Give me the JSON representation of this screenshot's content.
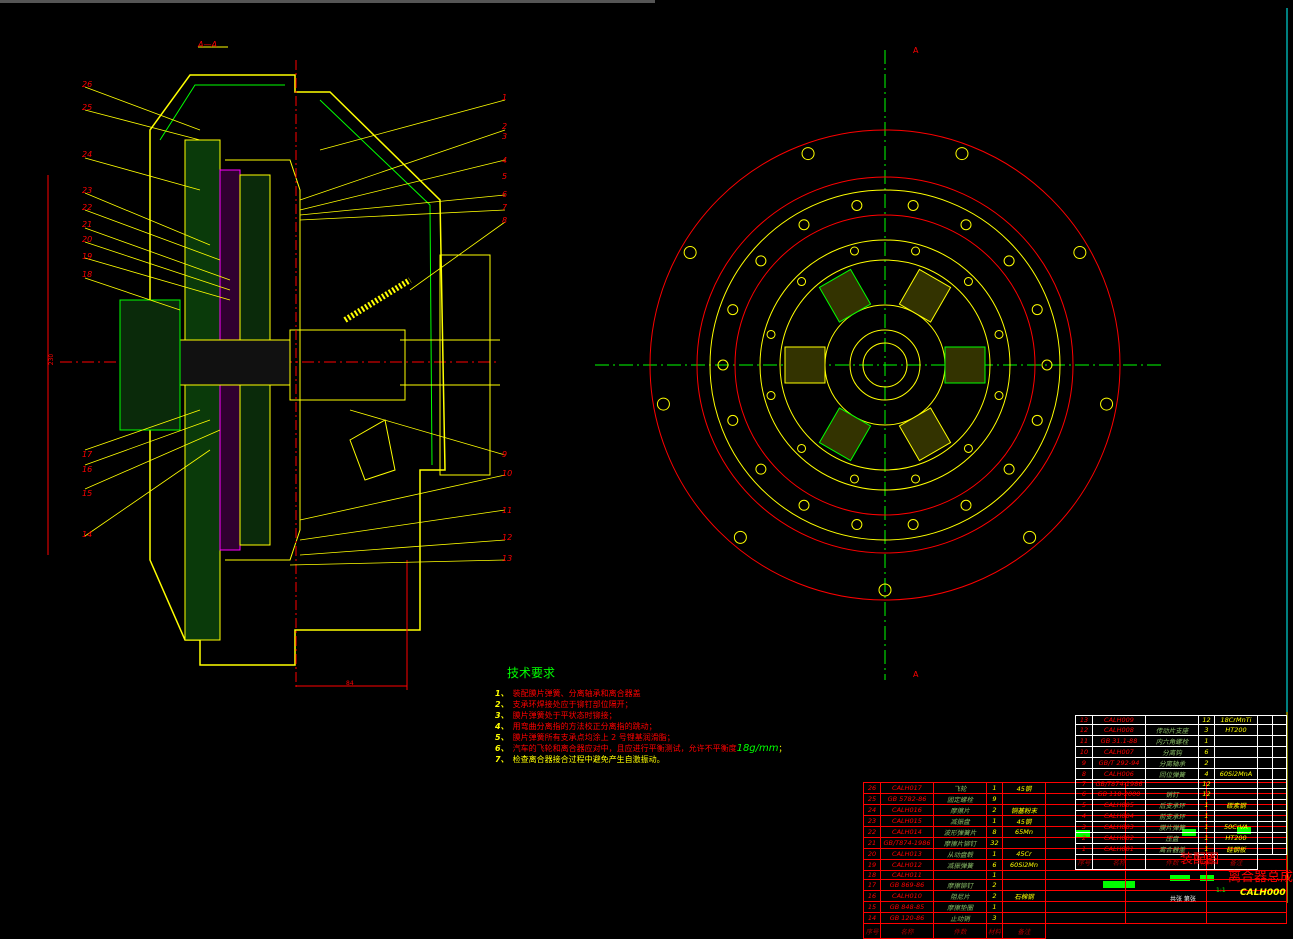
{
  "section_label": "A—A",
  "section_marks": [
    "A",
    "A"
  ],
  "dimensions": {
    "width": "84",
    "height": "230"
  },
  "leader_numbers_right": [
    "1",
    "2",
    "3",
    "4",
    "5",
    "6",
    "7",
    "8",
    "9",
    "10",
    "11",
    "12",
    "13"
  ],
  "leader_numbers_left": [
    "26",
    "25",
    "24",
    "23",
    "22",
    "21",
    "20",
    "19",
    "18",
    "17",
    "16",
    "15",
    "14"
  ],
  "tech": {
    "title": "技术要求",
    "items": [
      {
        "n": "1、",
        "text": "装配膜片弹簧、分离轴承和离合器盖"
      },
      {
        "n": "2、",
        "text": "支承环焊接处应于铆钉部位隔开；"
      },
      {
        "n": "3、",
        "text": "膜片弹簧处于平状态时铆接；"
      },
      {
        "n": "4、",
        "text": "用弯曲分离指的方法校正分离指的跳动；"
      },
      {
        "n": "5、",
        "text": "膜片弹簧所有支承点均涂上 2 号锂基润滑脂；"
      },
      {
        "n": "6、",
        "text": "汽车的飞轮和离合器应对中，且应进行平衡测试，允许不平衡度",
        "extra": "18g/mm",
        "end": "；"
      },
      {
        "n": "7、",
        "text": "检查离合器接合过程中避免产生自激振动。"
      }
    ]
  },
  "parts_lower": [
    [
      "26",
      "CALH017",
      "飞轮",
      "1",
      "45钢"
    ],
    [
      "25",
      "GB 5782-86",
      "固定螺栓",
      "9",
      ""
    ],
    [
      "24",
      "CALH016",
      "摩擦片",
      "2",
      "铜基粉末"
    ],
    [
      "23",
      "CALH015",
      "减振盘",
      "1",
      "45钢"
    ],
    [
      "22",
      "CALH014",
      "波形弹簧片",
      "8",
      "65Mn"
    ],
    [
      "21",
      "GB/T874-1986",
      "摩擦片铆钉",
      "32",
      ""
    ],
    [
      "20",
      "CALH013",
      "从动盘毂",
      "1",
      "45Cr"
    ],
    [
      "19",
      "CALH012",
      "减振弹簧",
      "6",
      "60Si2Mn"
    ],
    [
      "18",
      "CALH011",
      "",
      "1",
      ""
    ],
    [
      "17",
      "GB 869-86",
      "摩擦铆钉",
      "2",
      ""
    ],
    [
      "16",
      "CALH010",
      "阻尼片",
      "2",
      "石棉钢"
    ],
    [
      "15",
      "GB 848-85",
      "摩擦垫圈",
      "1",
      ""
    ],
    [
      "14",
      "GB 120-86",
      "止动销",
      "3",
      ""
    ]
  ],
  "parts_upper": [
    [
      "13",
      "CALH009",
      "",
      "12",
      "18CrMnTi"
    ],
    [
      "12",
      "CALH008",
      "传动片支座",
      "3",
      "HT200"
    ],
    [
      "11",
      "GB 31.1-88",
      "内六角螺栓",
      "1",
      ""
    ],
    [
      "10",
      "CALH007",
      "分离钩",
      "6",
      ""
    ],
    [
      "9",
      "GB/T 292-94",
      "分离轴承",
      "2",
      ""
    ],
    [
      "8",
      "CALH006",
      "回位弹簧",
      "4",
      "60Si2MnA"
    ],
    [
      "7",
      "GB/T874-1986",
      "",
      "12",
      ""
    ],
    [
      "6",
      "GB 118-2000",
      "销钉",
      "12",
      ""
    ],
    [
      "5",
      "CALH005",
      "后支承环",
      "1",
      "碳素钢"
    ],
    [
      "4",
      "CALH004",
      "前支承环",
      "1",
      ""
    ],
    [
      "3",
      "CALH003",
      "膜片弹簧",
      "1",
      "50CrVA"
    ],
    [
      "2",
      "CALH002",
      "压盘",
      "1",
      "HT200"
    ],
    [
      "1",
      "CALH001",
      "离合器盖",
      "1",
      "硅钢板"
    ]
  ],
  "table_headers": [
    "序号",
    "名称",
    "件数",
    "材料",
    "备注"
  ],
  "title_block": {
    "drawing_type": "装配图",
    "name": "离合器总成",
    "code": "CALH000",
    "scale": "1:1",
    "sheet": "共张 第张"
  }
}
